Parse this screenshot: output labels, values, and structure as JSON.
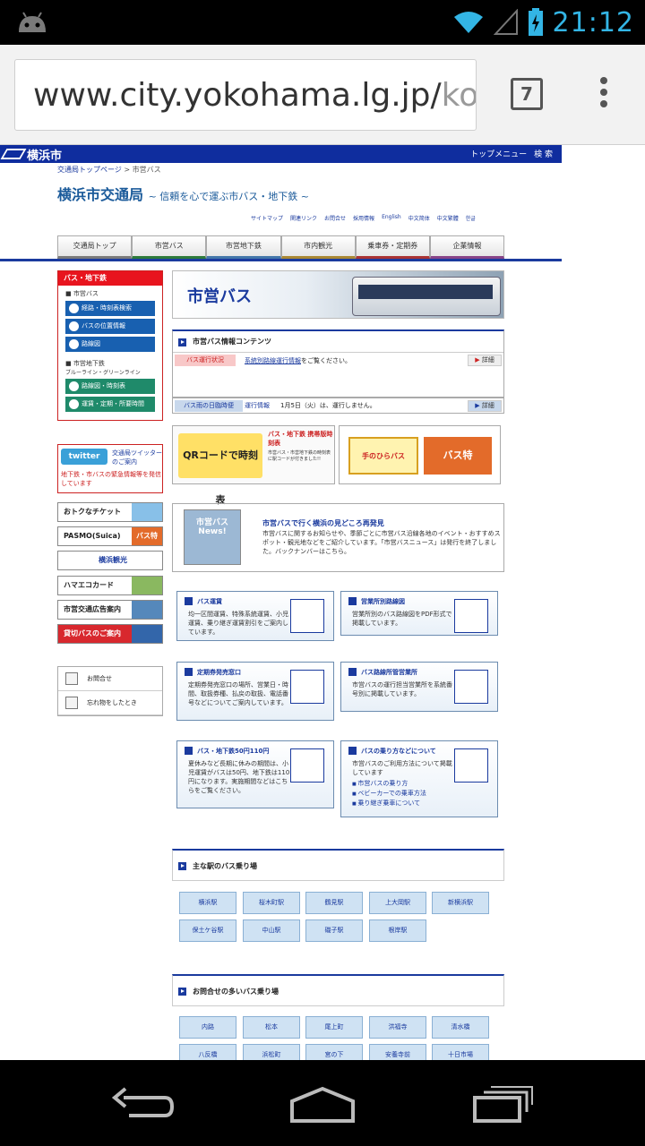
{
  "status": {
    "time": "21:12"
  },
  "browser": {
    "url_main": "www.city.yokohama.lg.jp/",
    "url_faded": "ko",
    "tab_count": "7"
  },
  "site": {
    "logo": "横浜市",
    "top_menu": "トップメニュー",
    "search": "検 索",
    "breadcrumb_home": "交通局トップページ",
    "breadcrumb_sep": " > ",
    "breadcrumb_current": "市営バス",
    "title": "横浜市交通局",
    "subtitle": "~ 信頼を心で運ぶ市バス・地下鉄 ~",
    "links": [
      "サイトマップ",
      "関連リンク",
      "お問合せ",
      "採用情報",
      "English",
      "中文简体",
      "中文繁體",
      "한글"
    ],
    "nav": [
      "交通局トップ",
      "市営バス",
      "市営地下鉄",
      "市内観光",
      "乗車券・定期券",
      "企業情報"
    ]
  },
  "sidebar": {
    "header": "バス・地下鉄",
    "bus_label": "■ 市営バス",
    "bus_items": [
      "経路・時刻表検索",
      "バスの位置情報",
      "路線図"
    ],
    "subway_label": "■ 市営地下鉄",
    "subway_lines": "ブルーライン・グリーンライン",
    "subway_items": [
      "路線図・時刻表",
      "運賃・定期・所要時間"
    ],
    "twitter_logo": "twitter",
    "twitter_text": "交通局ツイッターのご案内",
    "twitter_note": "地下鉄・市バスの緊急情報等を発信しています",
    "banners": [
      "おトクなチケット",
      "PASMO(Suica)",
      "横浜観光",
      "ハマエコカード",
      "市営交通広告案内",
      "貸切バスのご案内"
    ],
    "banner_tag": "バス特",
    "contact": "お問合せ",
    "lost": "忘れ物をしたとき"
  },
  "main": {
    "hero_title": "市営バス",
    "info_title": "市営バス情報コンテンツ",
    "status_pill": "バス運行状況",
    "status_link": "系統別路線運行情報",
    "status_text": "をご覧ください。",
    "more": "詳細",
    "rain_pill": "バス雨の日臨時便",
    "rain_label": "運行情報",
    "rain_text": "1月5日（火）は、運行しません。",
    "qr_image": "QRコードで時刻表",
    "qr_title": "バス・地下鉄 携帯版時刻表",
    "qr_sub": "市営バス・市営地下鉄の時刻表に駅コードが付きました!!",
    "hira_label": "手のひらバス",
    "hira_tag": "バス特",
    "news_image": "市営バス News!",
    "news_title": "市営バスで行く横浜の見どころ再発見",
    "news_body": "市営バスに関するお知らせや、季節ごとに市営バス沿線各地のイベント・おすすめスポット・観光地などをご紹介しています。「市営バスニュース」は発行を終了しました。バックナンバーはこちら。",
    "cards": [
      {
        "title": "バス運賃",
        "body": "均一区間運賃、特殊系統運賃、小児運賃、乗り継ぎ運賃割引をご案内しています。"
      },
      {
        "title": "営業所別路線図",
        "body": "営業所別のバス路線図をPDF形式で掲載しています。"
      },
      {
        "title": "定期券発売窓口",
        "body": "定期券発売窓口の場所、営業日・時間、取扱券種、払戻の取扱、電話番号などについてご案内しています。"
      },
      {
        "title": "バス路線所管営業所",
        "body": "市営バスの運行担当営業所を系統番号別に掲載しています。"
      },
      {
        "title": "バス・地下鉄50円110円",
        "body": "夏休みなど長期に休みの期間は、小児運賃がバスは50円、地下鉄は110円になります。実施期間などはこちらをご覧ください。"
      },
      {
        "title": "バスの乗り方などについて",
        "body": "市営バスのご利用方法について掲載しています",
        "links": [
          "市営バスの乗り方",
          "ベビーカーでの乗車方法",
          "乗り継ぎ乗車について"
        ]
      }
    ],
    "stations_title": "主な駅のバス乗り場",
    "stations": [
      "横浜駅",
      "桜木町駅",
      "鶴見駅",
      "上大岡駅",
      "新横浜駅",
      "保土ケ谷駅",
      "中山駅",
      "磯子駅",
      "根岸駅"
    ],
    "popular_title": "お問合せの多いバス乗り場",
    "popular": [
      "内路",
      "松本",
      "尾上町",
      "洪福寺",
      "清水橋",
      "八反橋",
      "浜松町",
      "宮の下",
      "安養寺前",
      "十日市場"
    ]
  }
}
